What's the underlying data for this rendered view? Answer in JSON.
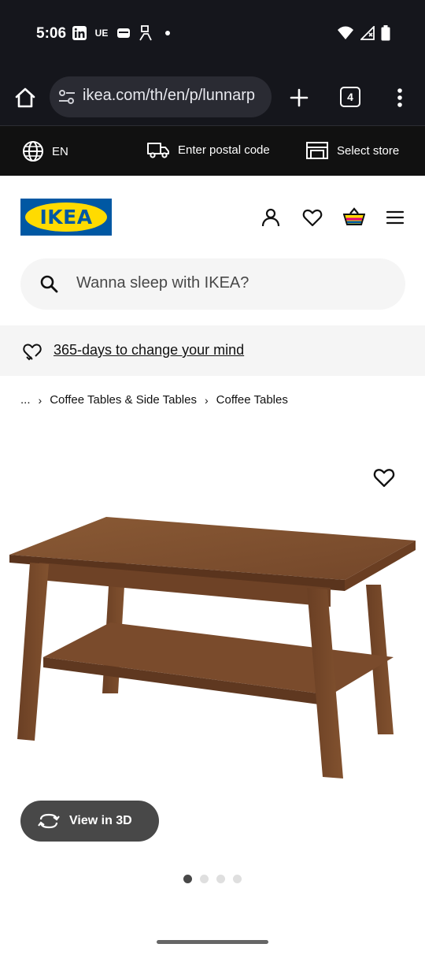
{
  "status_bar": {
    "time": "5:06",
    "left_icons": [
      "linkedin-icon",
      "ue-text-icon",
      "wallet-icon",
      "accessibility-icon",
      "dot-icon"
    ],
    "ue_label": "UE",
    "right_icons": [
      "wifi-icon",
      "signal-icon",
      "battery-icon"
    ]
  },
  "browser": {
    "url": "ikea.com/th/en/p/lunnarp",
    "tab_count": "4"
  },
  "utility_bar": {
    "language": "EN",
    "postal_code": "Enter postal code",
    "store": "Select store"
  },
  "header": {
    "logo_text": "IKEA",
    "brand_colors": {
      "blue": "#0058a3",
      "yellow": "#ffdb00"
    }
  },
  "search": {
    "placeholder": "Wanna sleep with IKEA?"
  },
  "promo": {
    "text": "365-days to change your mind"
  },
  "breadcrumb": {
    "items": [
      "...",
      "Coffee Tables & Side Tables",
      "Coffee Tables"
    ]
  },
  "product": {
    "view_3d_label": "View in 3D",
    "image_count": 4,
    "active_image": 1
  }
}
